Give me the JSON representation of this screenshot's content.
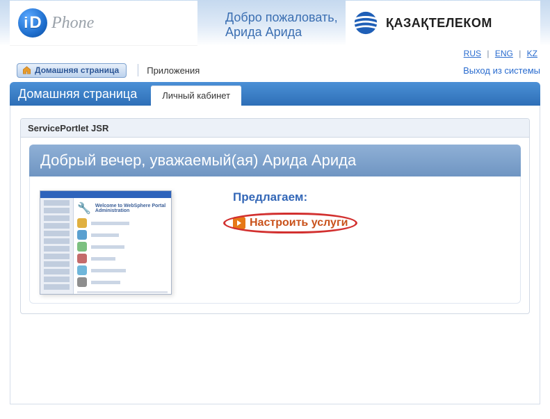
{
  "header": {
    "product_primary": "iD",
    "product_secondary": "Phone",
    "welcome_line1": "Добро пожаловать,",
    "welcome_line2": "Арида Арида",
    "brand_name": "ҚАЗАҚТЕЛЕКОМ"
  },
  "lang": {
    "rus": "RUS",
    "eng": "ENG",
    "kz": "KZ"
  },
  "nav": {
    "home": "Домашняя страница",
    "apps": "Приложения",
    "logout": "Выход из системы"
  },
  "page": {
    "title": "Домашняя страница",
    "tab": "Личный кабинет"
  },
  "portlet": {
    "label": "ServicePortlet JSR",
    "greeting": "Добрый вечер, уважаемый(ая) Арида Арида",
    "thumb_title": "Welcome to WebSphere Portal Administration",
    "offer_title": "Предлагаем:",
    "offer_link": "Настроить услуги"
  }
}
